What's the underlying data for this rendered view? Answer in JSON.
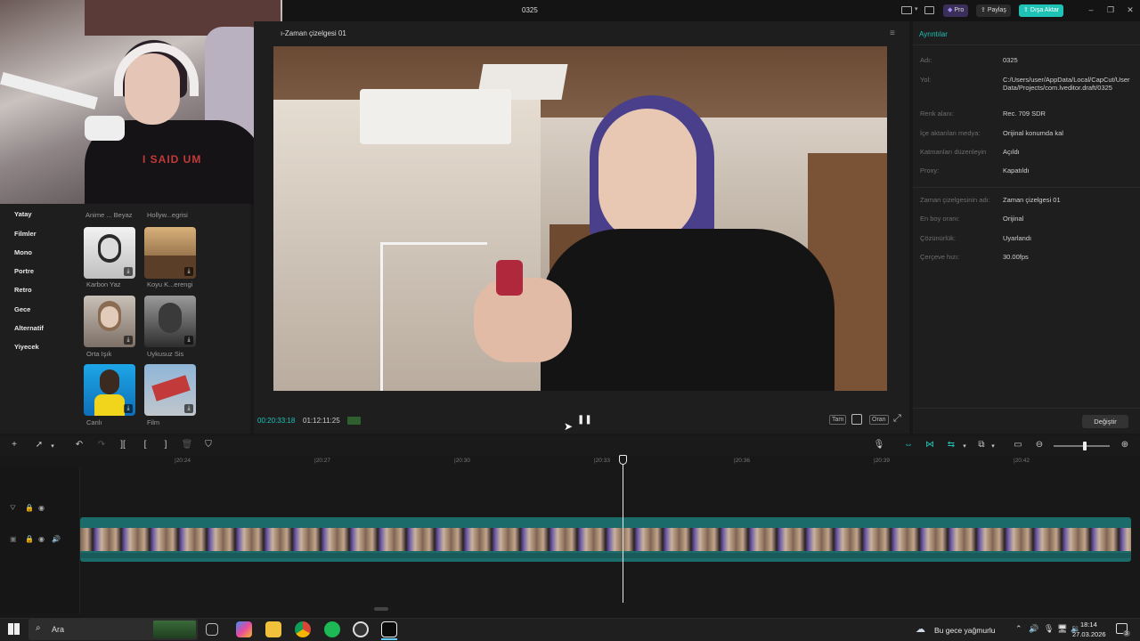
{
  "window": {
    "title": "0325"
  },
  "header_buttons": {
    "pro": "Pro",
    "share": "Paylaş",
    "export": "Dışa Aktar"
  },
  "webcam": {
    "shirt_text": "I SAID UM"
  },
  "filters": {
    "categories": [
      "Yatay",
      "Filmler",
      "Mono",
      "Portre",
      "Retro",
      "Gece",
      "Alternatif",
      "Yiyecek"
    ],
    "top_labels": [
      "Anime ... Beyaz",
      "Hollyw...egrisi"
    ],
    "items": [
      {
        "label": "Karbon Yaz"
      },
      {
        "label": "Koyu K...erengi"
      },
      {
        "label": "Orta Işık"
      },
      {
        "label": "Uykusuz Sis"
      },
      {
        "label": "Canlı"
      },
      {
        "label": "Film"
      }
    ]
  },
  "player": {
    "title": "ı-Zaman çizelgesi 01",
    "current_time": "00:20:33:18",
    "total_time": "01:12:11:25",
    "btn_full": "Tam",
    "btn_ratio": "Oran",
    "accent": "#1fc3b6"
  },
  "details": {
    "header": "Ayrıntılar",
    "rows": [
      {
        "label": "Adı:",
        "value": "0325"
      },
      {
        "label": "Yol:",
        "value": "C:/Users/user/AppData/Local/CapCut/User Data/Projects/com.lveditor.draft/0325"
      },
      {
        "label": "Renk alanı:",
        "value": "Rec. 709 SDR"
      },
      {
        "label": "İçe aktarılan medya:",
        "value": "Orijinal konumda kal"
      },
      {
        "label": "Katmanları düzenleyin",
        "value": "Açıldı"
      },
      {
        "label": "Proxy:",
        "value": "Kapatıldı"
      },
      {
        "label": "Zaman çizelgesinin adı:",
        "value": "Zaman çizelgesi 01"
      },
      {
        "label": "En boy oranı:",
        "value": "Orijinal"
      },
      {
        "label": "Çözünürlük:",
        "value": "Uyarlandı"
      },
      {
        "label": "Çerçeve hızı:",
        "value": "30.00fps"
      }
    ],
    "change_button": "Değiştir"
  },
  "timeline": {
    "ruler": [
      "|20:24",
      "|20:27",
      "|20:30",
      "|20:33",
      "|20:36",
      "|20:39",
      "|20:42"
    ]
  },
  "taskbar": {
    "search": "Ara",
    "weather": "Bu gece yağmurlu",
    "time": "18:14",
    "date": "27.03.2026",
    "notif": "3"
  }
}
